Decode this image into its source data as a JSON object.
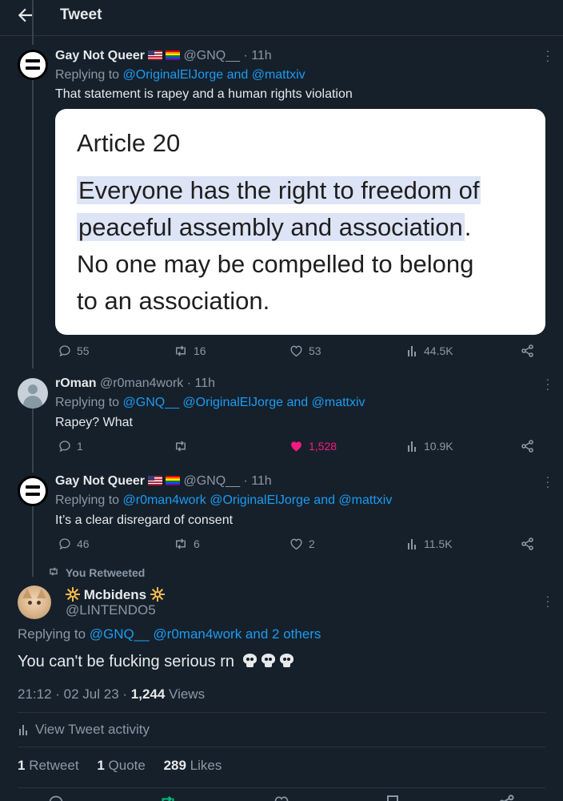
{
  "header": {
    "title": "Tweet"
  },
  "tweets": [
    {
      "display_name": "Gay Not Queer",
      "handle": "@GNQ__",
      "time": "· 11h",
      "replying_prefix": "Replying to",
      "replying_to": "@OriginalElJorge and @mattxiv",
      "text": "That statement is rapey and a human rights violation",
      "image": {
        "heading": "Article 20",
        "line1": "Everyone has the right to freedom of",
        "line2": "peaceful assembly and association",
        "line2_end": ".",
        "line3": "No one may be compelled to belong",
        "line4": "to an association."
      },
      "replies": "55",
      "retweets": "16",
      "likes": "53",
      "views": "44.5K"
    },
    {
      "display_name": "rOman",
      "handle": "@r0man4work",
      "time": "· 11h",
      "replying_prefix": "Replying to",
      "replying_to": "@GNQ__ @OriginalElJorge and @mattxiv",
      "text": "Rapey? What",
      "replies": "1",
      "retweets": "",
      "likes": "1,528",
      "views": "10.9K"
    },
    {
      "display_name": "Gay Not Queer",
      "handle": "@GNQ__",
      "time": "· 11h",
      "replying_prefix": "Replying to",
      "replying_to": "@r0man4work @OriginalElJorge and @mattxiv",
      "text": "It’s a clear disregard of consent",
      "replies": "46",
      "retweets": "6",
      "likes": "2",
      "views": "11.5K"
    }
  ],
  "main_tweet": {
    "retweeted_label": "You Retweeted",
    "display_name": "Mcbidens",
    "handle": "@LINTENDO5",
    "replying_prefix": "Replying to",
    "replying_to": "@GNQ__ @r0man4work and 2 others",
    "text": "You can't be fucking serious rn",
    "timestamp": "21:12 · 02 Jul 23 ·",
    "views_count": "1,244",
    "views_label": "Views",
    "activity_label": "View Tweet activity",
    "retweet_count": "1",
    "retweet_label": "Retweet",
    "quote_count": "1",
    "quote_label": "Quote",
    "like_count": "289",
    "like_label": "Likes"
  },
  "colors": {
    "background": "#15202b",
    "link": "#1d9bf0",
    "muted": "#8b98a5",
    "like": "#f91880",
    "retweet_green": "#00ba7c"
  }
}
